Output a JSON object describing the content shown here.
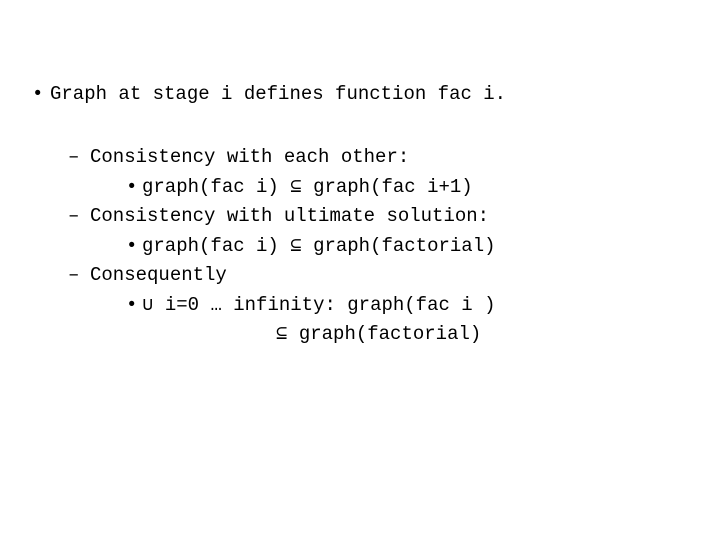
{
  "bullet": "•",
  "dash": "–",
  "dot": "•",
  "main": "Graph at stage i defines function fac i.",
  "items": [
    {
      "label": "Consistency with each other:",
      "sub": "graph(fac i) ⊆ graph(fac i+1)"
    },
    {
      "label": "Consistency with ultimate solution:",
      "sub": "graph(fac i) ⊆ graph(factorial)"
    },
    {
      "label": "Consequently",
      "sub": "∪ i=0 … infinity: graph(fac i )",
      "sub2": "⊆ graph(factorial)"
    }
  ]
}
